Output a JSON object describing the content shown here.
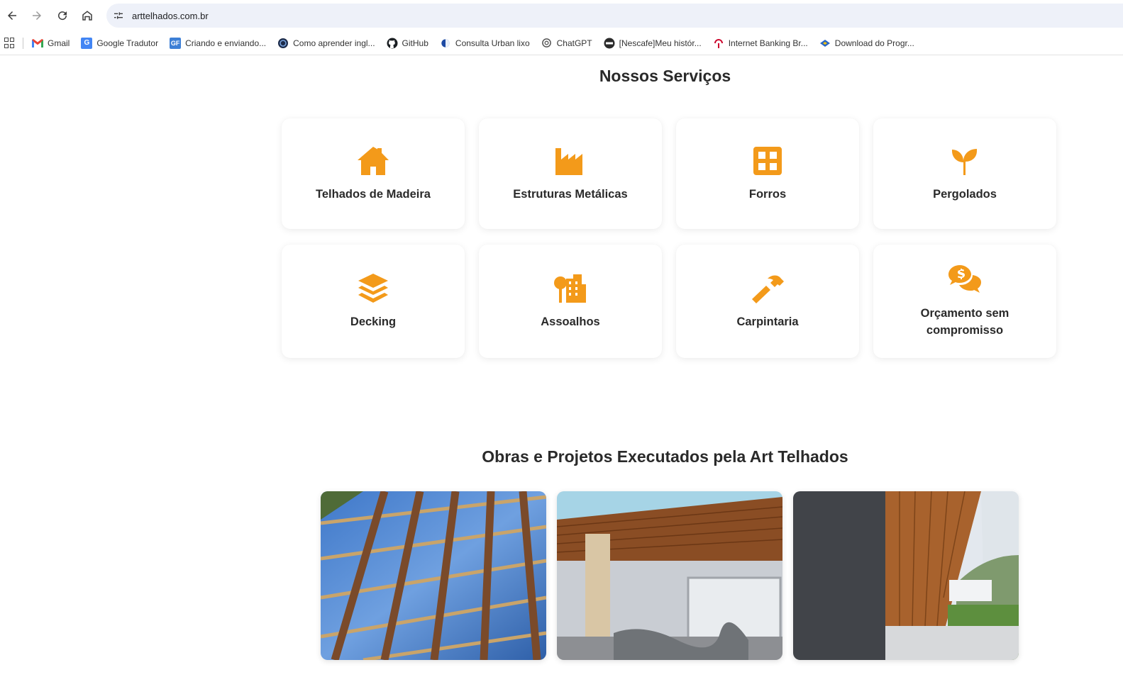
{
  "browser": {
    "url": "arttelhados.com.br",
    "bookmarks": [
      {
        "label": "Gmail",
        "icon": "gmail-icon"
      },
      {
        "label": "Google Tradutor",
        "icon": "translate-icon"
      },
      {
        "label": "Criando e enviando...",
        "icon": "gf-icon"
      },
      {
        "label": "Como aprender ingl...",
        "icon": "globe-icon"
      },
      {
        "label": "GitHub",
        "icon": "github-icon"
      },
      {
        "label": "Consulta Urban lixo",
        "icon": "circle-icon"
      },
      {
        "label": "ChatGPT",
        "icon": "chatgpt-icon"
      },
      {
        "label": "[Nescafe]Meu histór...",
        "icon": "nescafe-icon"
      },
      {
        "label": "Internet Banking Br...",
        "icon": "bank-icon"
      },
      {
        "label": "Download do Progr...",
        "icon": "download-icon"
      }
    ]
  },
  "services": {
    "title": "Nossos Serviços",
    "items": [
      {
        "label": "Telhados de Madeira",
        "icon": "house-icon"
      },
      {
        "label": "Estruturas Metálicas",
        "icon": "industry-icon"
      },
      {
        "label": "Forros",
        "icon": "grid-icon"
      },
      {
        "label": "Pergolados",
        "icon": "seedling-icon"
      },
      {
        "label": "Decking",
        "icon": "layers-icon"
      },
      {
        "label": "Assoalhos",
        "icon": "city-icon"
      },
      {
        "label": "Carpintaria",
        "icon": "hammer-icon"
      },
      {
        "label": "Orçamento sem compromisso",
        "icon": "comments-dollar-icon"
      }
    ]
  },
  "projects": {
    "title": "Obras e Projetos Executados pela Art Telhados",
    "photos": [
      "roof-structure-photo",
      "wood-ceiling-photo",
      "eave-ceiling-photo"
    ]
  },
  "colors": {
    "accent": "#f39a1a"
  }
}
